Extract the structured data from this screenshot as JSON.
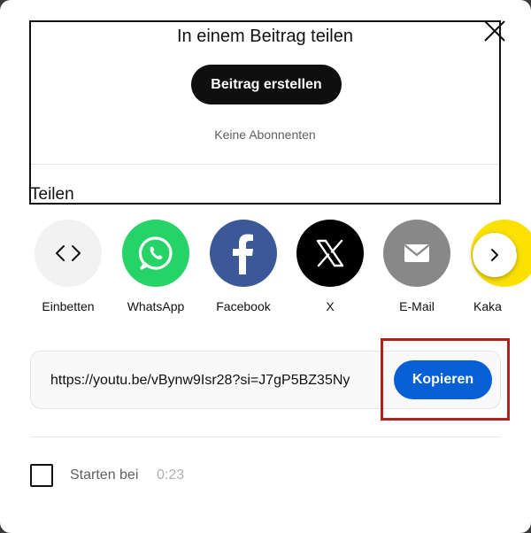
{
  "post": {
    "title": "In einem Beitrag teilen",
    "create_button": "Beitrag erstellen",
    "no_subscribers": "Keine Abonnenten"
  },
  "share": {
    "heading": "Teilen",
    "items": [
      {
        "label": "Einbetten",
        "icon": "embed-icon",
        "color": "#f2f2f2"
      },
      {
        "label": "WhatsApp",
        "icon": "whatsapp-icon",
        "color": "#25d366"
      },
      {
        "label": "Facebook",
        "icon": "facebook-icon",
        "color": "#3b5998"
      },
      {
        "label": "X",
        "icon": "x-icon",
        "color": "#000000"
      },
      {
        "label": "E-Mail",
        "icon": "email-icon",
        "color": "#888888"
      },
      {
        "label": "Kaka",
        "icon": "kakao-icon",
        "color": "#fae100"
      }
    ],
    "next_icon": "chevron-right-icon"
  },
  "link": {
    "url": "https://youtu.be/vBynw9Isr28?si=J7gP5BZ35Ny",
    "copy_button": "Kopieren"
  },
  "start": {
    "label": "Starten bei",
    "time": "0:23"
  },
  "colors": {
    "accent": "#065fd4",
    "highlight": "#b0201c"
  }
}
